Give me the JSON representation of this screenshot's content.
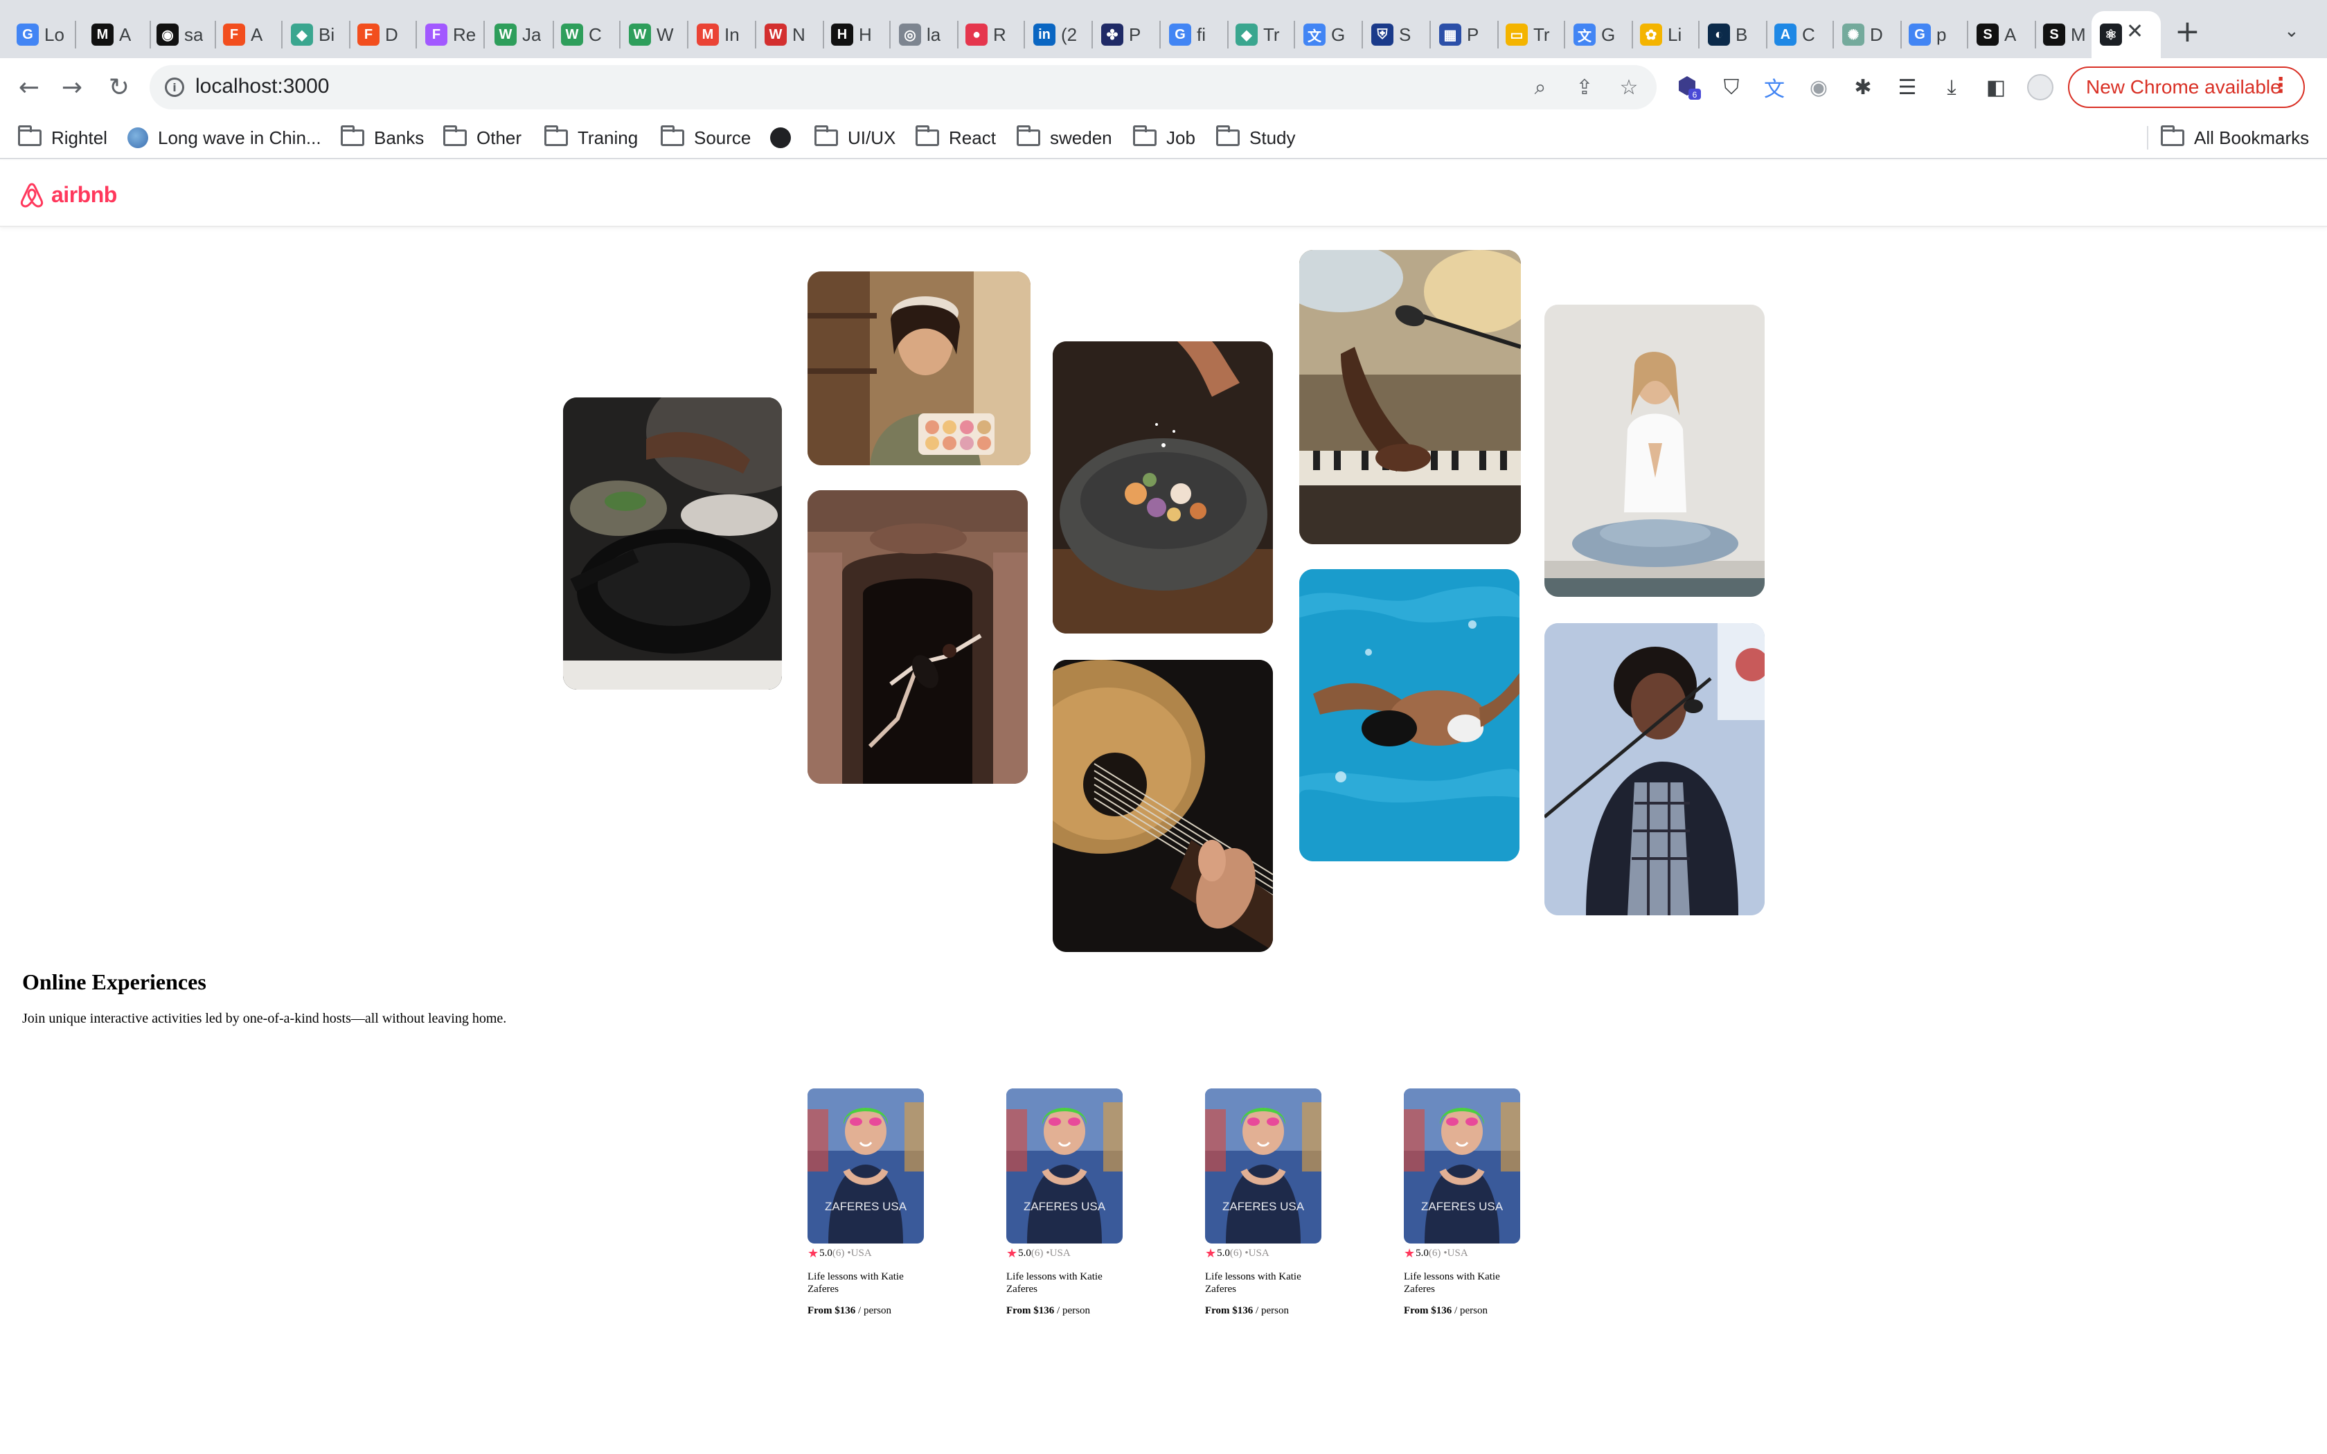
{
  "browser": {
    "tabs": [
      {
        "label": "Lo",
        "icon": "google-icon",
        "color": "#4285f4",
        "glyph": "G"
      },
      {
        "label": "A",
        "icon": "medium-icon",
        "color": "#111111",
        "glyph": "M"
      },
      {
        "label": "sa",
        "icon": "github-icon",
        "color": "#111111",
        "glyph": "◉"
      },
      {
        "label": "A",
        "icon": "figma-icon",
        "color": "#f24e1e",
        "glyph": "F"
      },
      {
        "label": "Bi",
        "icon": "diamond-icon",
        "color": "#3aa68f",
        "glyph": "◆"
      },
      {
        "label": "D",
        "icon": "figma-icon",
        "color": "#f24e1e",
        "glyph": "F"
      },
      {
        "label": "Re",
        "icon": "figma-icon",
        "color": "#a259ff",
        "glyph": "F"
      },
      {
        "label": "Ja",
        "icon": "w-icon",
        "color": "#2e9e5b",
        "glyph": "W"
      },
      {
        "label": "C",
        "icon": "w-icon",
        "color": "#2e9e5b",
        "glyph": "W"
      },
      {
        "label": "W",
        "icon": "w-icon",
        "color": "#2e9e5b",
        "glyph": "W"
      },
      {
        "label": "In",
        "icon": "gmail-icon",
        "color": "#ea4335",
        "glyph": "M"
      },
      {
        "label": "N",
        "icon": "wave-icon",
        "color": "#d32f2f",
        "glyph": "W"
      },
      {
        "label": "H",
        "icon": "h-icon",
        "color": "#111111",
        "glyph": "H"
      },
      {
        "label": "la",
        "icon": "globe-icon",
        "color": "#7d8590",
        "glyph": "◎"
      },
      {
        "label": "R",
        "icon": "r-icon",
        "color": "#e5364d",
        "glyph": "●"
      },
      {
        "label": "(2",
        "icon": "linkedin-icon",
        "color": "#0a66c2",
        "glyph": "in"
      },
      {
        "label": "P",
        "icon": "clover-icon",
        "color": "#1f2a66",
        "glyph": "✤"
      },
      {
        "label": "fi",
        "icon": "google-icon",
        "color": "#4285f4",
        "glyph": "G"
      },
      {
        "label": "Tr",
        "icon": "diamond-icon",
        "color": "#3aa68f",
        "glyph": "◆"
      },
      {
        "label": "G",
        "icon": "translate-icon",
        "color": "#4285f4",
        "glyph": "文"
      },
      {
        "label": "S",
        "icon": "shield-icon",
        "color": "#1a3a8a",
        "glyph": "⛨"
      },
      {
        "label": "P",
        "icon": "window-icon",
        "color": "#2b4fa8",
        "glyph": "▦"
      },
      {
        "label": "Tr",
        "icon": "slides-icon",
        "color": "#f4b400",
        "glyph": "▭"
      },
      {
        "label": "G",
        "icon": "translate-icon",
        "color": "#4285f4",
        "glyph": "文"
      },
      {
        "label": "Li",
        "icon": "colorful-icon",
        "color": "#f4b400",
        "glyph": "✿"
      },
      {
        "label": "B",
        "icon": "b-icon",
        "color": "#0b2a4a",
        "glyph": "◐"
      },
      {
        "label": "C",
        "icon": "appstore-icon",
        "color": "#1e88e5",
        "glyph": "A"
      },
      {
        "label": "D",
        "icon": "chatgpt-icon",
        "color": "#74aa9c",
        "glyph": "✺"
      },
      {
        "label": "p",
        "icon": "google-icon",
        "color": "#4285f4",
        "glyph": "G"
      },
      {
        "label": "A",
        "icon": "s-icon",
        "color": "#111111",
        "glyph": "S"
      },
      {
        "label": "M",
        "icon": "s-icon",
        "color": "#111111",
        "glyph": "S"
      },
      {
        "label": "",
        "icon": "react-icon",
        "color": "#1b1f24",
        "glyph": "⚛"
      }
    ],
    "url": "localhost:3000",
    "update_label": "New Chrome available",
    "extension_badge": "6",
    "bookmarks": [
      {
        "label": "Rightel",
        "type": "folder"
      },
      {
        "label": "Long wave in Chin...",
        "type": "globe"
      },
      {
        "label": "Banks",
        "type": "folder"
      },
      {
        "label": "Other",
        "type": "folder"
      },
      {
        "label": "Traning",
        "type": "folder"
      },
      {
        "label": "Source",
        "type": "folder"
      },
      {
        "label": "",
        "type": "world"
      },
      {
        "label": "UI/UX",
        "type": "folder"
      },
      {
        "label": "React",
        "type": "folder"
      },
      {
        "label": "sweden",
        "type": "folder"
      },
      {
        "label": "Job",
        "type": "folder"
      },
      {
        "label": "Study",
        "type": "folder"
      }
    ],
    "all_bookmarks": "All Bookmarks"
  },
  "header": {
    "logo": "airbnb"
  },
  "hero": {
    "photos": [
      {
        "name": "photo-cooking-pan",
        "alt": "Hands cooking at a stove with a pan"
      },
      {
        "name": "photo-woman-macarons",
        "alt": "Woman holding a box of macarons"
      },
      {
        "name": "photo-dancer-doorway",
        "alt": "Dancer leaping in an ornate doorway"
      },
      {
        "name": "photo-stone-bowl-dish",
        "alt": "Seasoning a dish in a stone bowl"
      },
      {
        "name": "photo-guitar",
        "alt": "Hands playing an acoustic guitar"
      },
      {
        "name": "photo-piano-microphone",
        "alt": "Playing piano in front of a microphone"
      },
      {
        "name": "photo-swimmer-pool",
        "alt": "Swimmer in a blue pool"
      },
      {
        "name": "photo-yoga",
        "alt": "Woman meditating in a yoga pose"
      },
      {
        "name": "photo-singer",
        "alt": "Singer with a microphone"
      }
    ]
  },
  "section": {
    "title": "Online Experiences",
    "subtitle": "Join unique interactive activities led by one-of-a-kind hosts—all without leaving home."
  },
  "cards": [
    {
      "rating": "5.0",
      "reviews": "(6)",
      "location": "•USA",
      "title": "Life lessons with Katie Zaferes",
      "price_prefix": "From $136",
      "price_suffix": "/ person",
      "jersey": "ZAFERES USA"
    },
    {
      "rating": "5.0",
      "reviews": "(6)",
      "location": "•USA",
      "title": "Life lessons with Katie Zaferes",
      "price_prefix": "From $136",
      "price_suffix": "/ person",
      "jersey": "ZAFERES USA"
    },
    {
      "rating": "5.0",
      "reviews": "(6)",
      "location": "•USA",
      "title": "Life lessons with Katie Zaferes",
      "price_prefix": "From $136",
      "price_suffix": "/ person",
      "jersey": "ZAFERES USA"
    },
    {
      "rating": "5.0",
      "reviews": "(6)",
      "location": "•USA",
      "title": "Life lessons with Katie Zaferes",
      "price_prefix": "From $136",
      "price_suffix": "/ person",
      "jersey": "ZAFERES USA"
    }
  ],
  "colors": {
    "brand": "#ff385c",
    "update_red": "#d93025"
  }
}
